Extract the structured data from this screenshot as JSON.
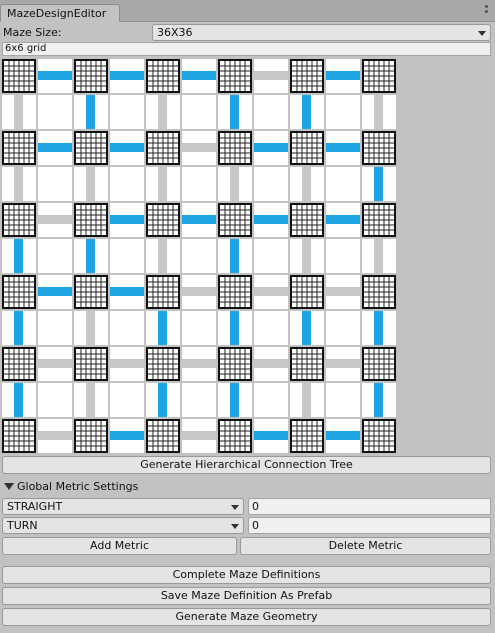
{
  "window": {
    "tab_title": "MazeDesignEditor"
  },
  "maze_size": {
    "label": "Maze Size:",
    "selected": "36X36"
  },
  "grid_info": "6x6 grid",
  "maze": {
    "rows": 6,
    "cols": 6,
    "horizontal_connections": [
      [
        true,
        true,
        true,
        false,
        true
      ],
      [
        true,
        true,
        false,
        true,
        true
      ],
      [
        false,
        true,
        true,
        true,
        true
      ],
      [
        true,
        true,
        false,
        false,
        false
      ],
      [
        false,
        false,
        false,
        false,
        false
      ],
      [
        false,
        true,
        false,
        true,
        true
      ]
    ],
    "vertical_connections": [
      [
        false,
        true,
        false,
        true,
        true,
        false
      ],
      [
        false,
        false,
        false,
        false,
        false,
        true
      ],
      [
        true,
        true,
        false,
        true,
        false,
        false
      ],
      [
        true,
        false,
        true,
        true,
        true,
        true
      ],
      [
        true,
        false,
        true,
        true,
        false,
        true
      ]
    ]
  },
  "buttons": {
    "generate_tree": "Generate Hierarchical Connection Tree",
    "add_metric": "Add Metric",
    "delete_metric": "Delete Metric",
    "complete_definitions": "Complete Maze Definitions",
    "save_prefab": "Save Maze Definition As Prefab",
    "generate_geometry": "Generate Maze Geometry"
  },
  "global_metrics": {
    "title": "Global Metric Settings",
    "rows": [
      {
        "type": "STRAIGHT",
        "value": "0"
      },
      {
        "type": "TURN",
        "value": "0"
      }
    ]
  },
  "colors": {
    "connected": "#1ea3e3",
    "disconnected": "#c8c8c8"
  }
}
